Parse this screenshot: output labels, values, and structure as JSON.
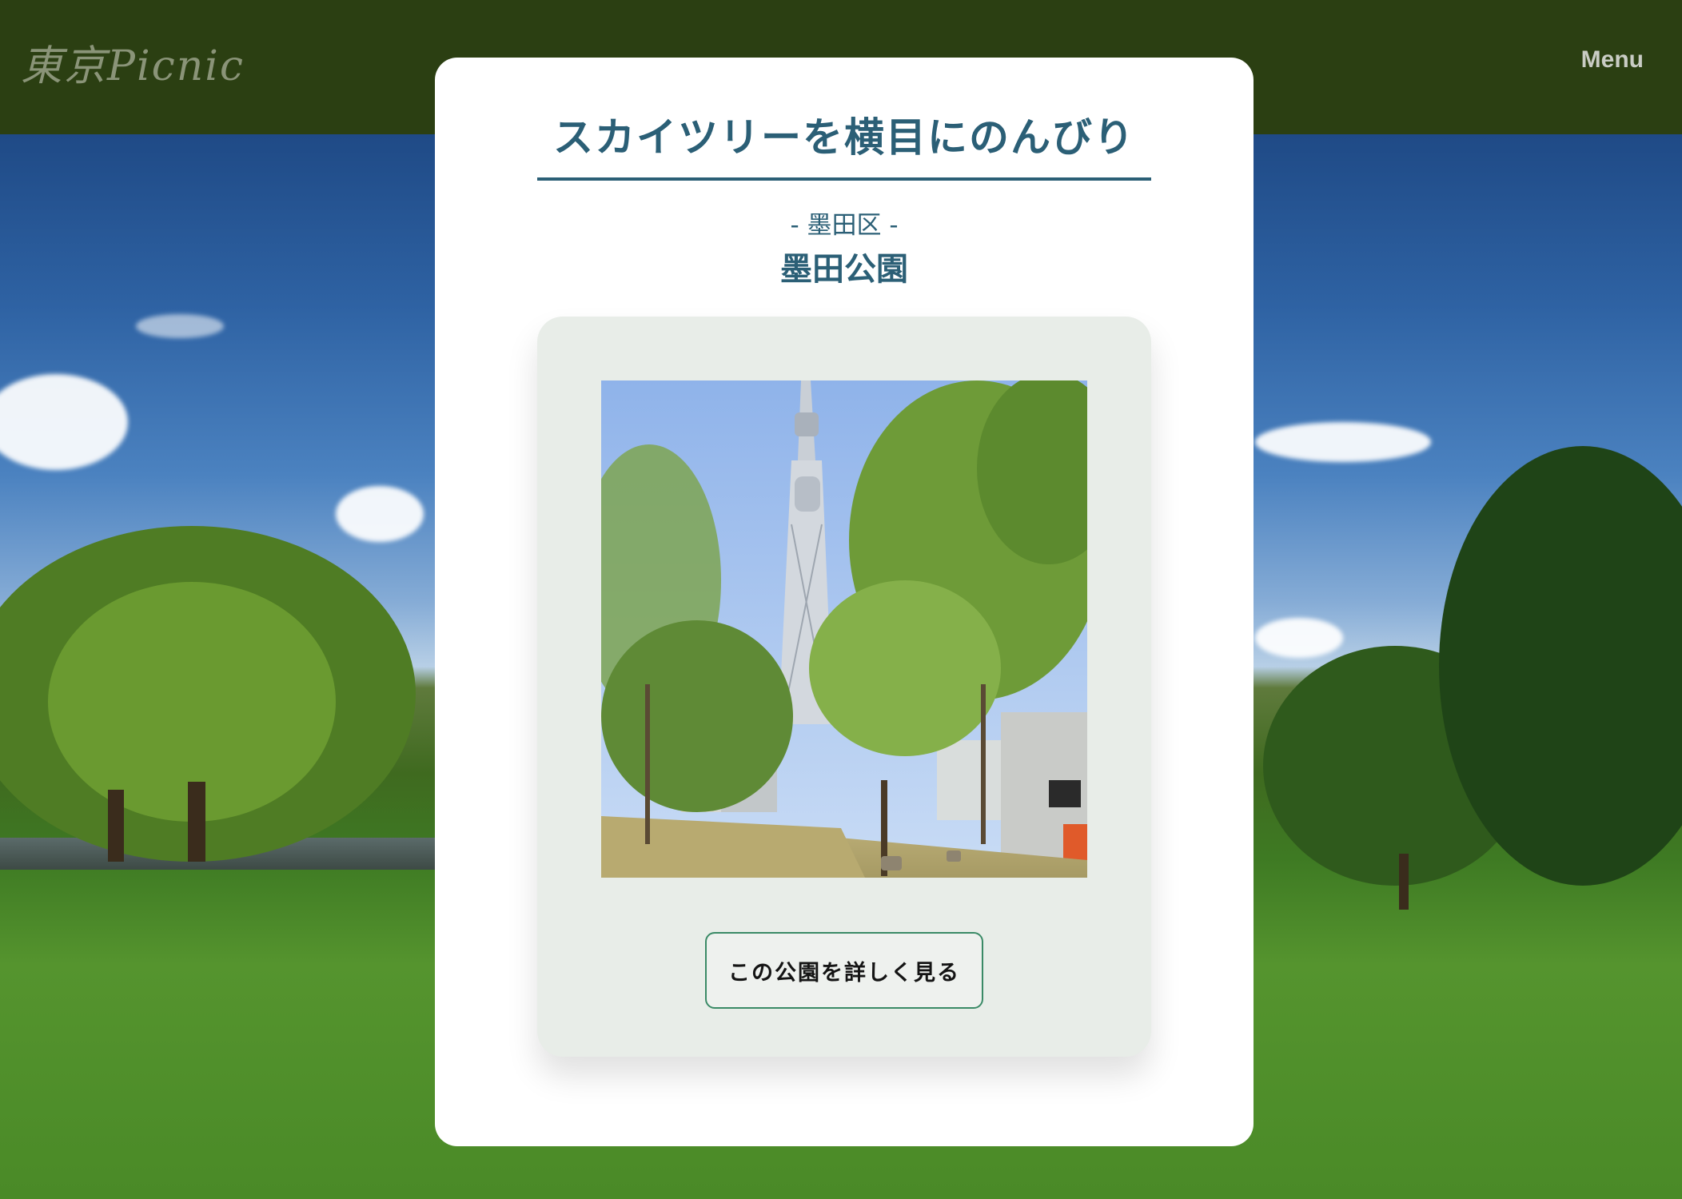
{
  "header": {
    "logo_text": "東京Picnic",
    "menu_label": "Menu"
  },
  "modal": {
    "title": "スカイツリーを横目にのんびり",
    "ward": "- 墨田区 -",
    "park_name": "墨田公園",
    "photo_icon": "skytree-park-photo",
    "detail_button_label": "この公園を詳しく見る"
  },
  "colors": {
    "header_bg": "#2b3f12",
    "title": "#2b5f76",
    "button_border": "#3a8a66",
    "card_bg": "#e8ede8"
  }
}
